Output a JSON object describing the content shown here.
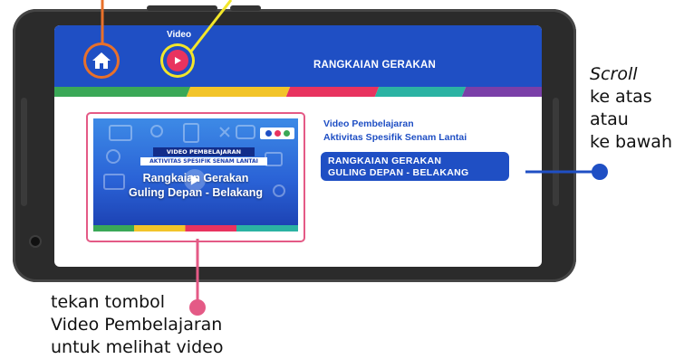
{
  "app": {
    "title": "RANGKAIAN GERAKAN",
    "video_caption": "Video",
    "home_icon": "home-icon",
    "play_icon": "play-icon"
  },
  "header_stripes": [
    "#3aa857",
    "#f2c42a",
    "#e8335f",
    "#2bb3a3",
    "#7a3fa8"
  ],
  "video_card": {
    "tag_line1": "VIDEO PEMBELAJARAN",
    "tag_line2": "AKTIVITAS SPESIFIK SENAM LANTAI",
    "title_line1": "Rangkaian Gerakan",
    "title_line2": "Guling Depan - Belakang"
  },
  "content": {
    "subtitle_line1": "Video Pembelajaran",
    "subtitle_line2": "Aktivitas Spesifik Senam Lantai",
    "active_line1": "RANGKAIAN GERAKAN",
    "active_line2": "GULING DEPAN - BELAKANG"
  },
  "annotations": {
    "scroll_word": "Scroll",
    "scroll_line2": "ke atas",
    "scroll_line3": "atau",
    "scroll_line4": "ke bawah",
    "tap_line1": "tekan tombol",
    "tap_line2": "Video Pembelajaran",
    "tap_line3": "untuk melihat video"
  },
  "colors": {
    "brand_blue": "#1f4fc4",
    "home_ring": "#e8702a",
    "video_ring": "#f2e62a",
    "tap_marker": "#e45a86",
    "scroll_marker": "#1f4fc4"
  }
}
